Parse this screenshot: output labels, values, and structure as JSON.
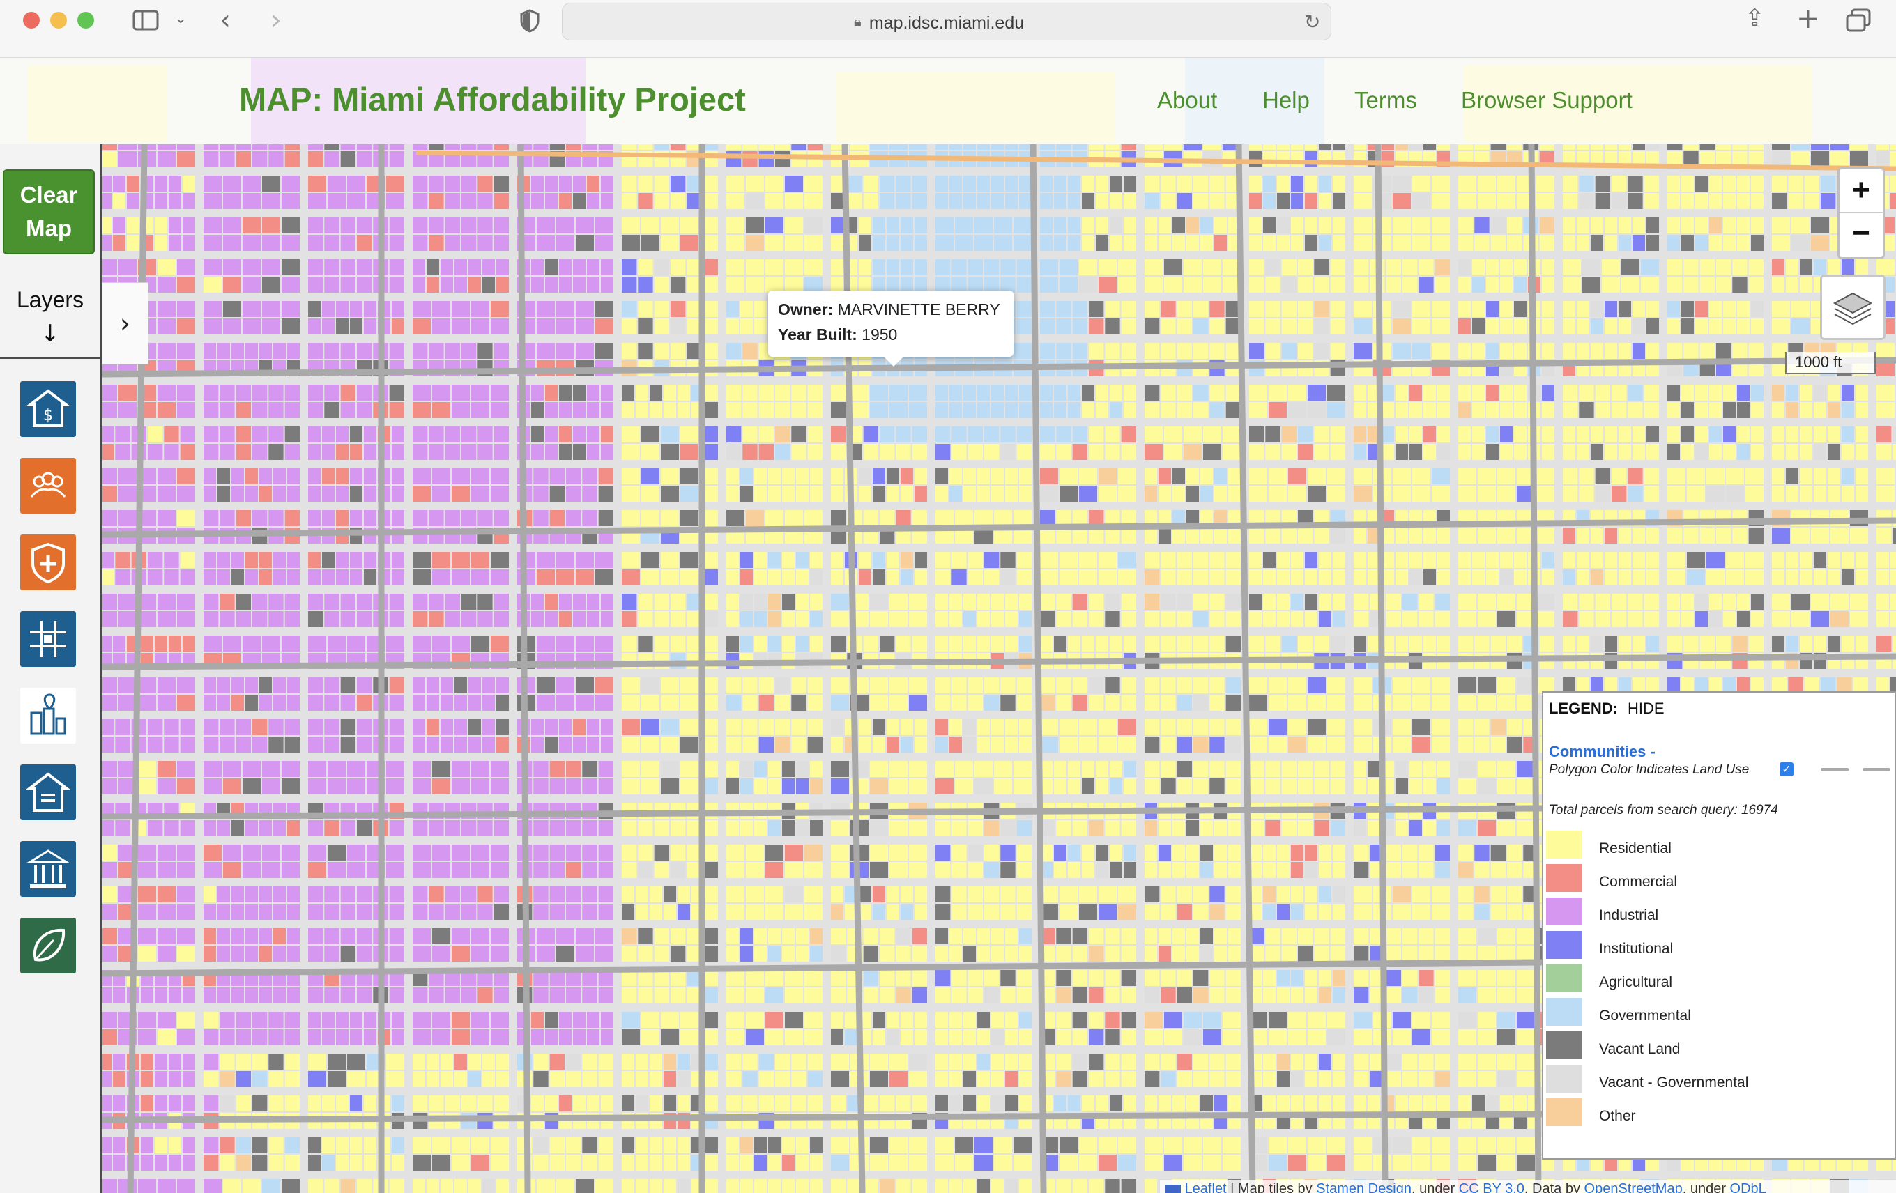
{
  "browser": {
    "url": "map.idsc.miami.edu",
    "traffic_colors": [
      "#ed6a5e",
      "#f5bf4f",
      "#61c554"
    ]
  },
  "header": {
    "title": "MAP: Miami Affordability Project",
    "nav": [
      {
        "label": "About"
      },
      {
        "label": "Help"
      },
      {
        "label": "Terms"
      },
      {
        "label": "Browser Support"
      }
    ]
  },
  "sidebar": {
    "clear_button": "Clear Map",
    "layers_label": "Layers",
    "layers_arrow": "↓",
    "expand_arrow": "›",
    "icons": [
      {
        "name": "housing-price-icon",
        "color": "#1f5f8f"
      },
      {
        "name": "community-icon",
        "color": "#e26f2c"
      },
      {
        "name": "health-shield-icon",
        "color": "#e26f2c"
      },
      {
        "name": "grid-plan-icon",
        "color": "#1f5f8f"
      },
      {
        "name": "location-city-icon",
        "color": "#1f5f8f"
      },
      {
        "name": "home-list-icon",
        "color": "#1f5f8f"
      },
      {
        "name": "government-building-icon",
        "color": "#1f5f8f"
      },
      {
        "name": "environment-leaf-icon",
        "color": "#2f6b47"
      }
    ]
  },
  "map": {
    "tooltip": {
      "owner_label": "Owner:",
      "owner_value": "MARVINETTE BERRY",
      "year_label": "Year Built:",
      "year_value": "1950"
    },
    "zoom_in": "+",
    "zoom_out": "−",
    "scale_label": "1000 ft"
  },
  "legend": {
    "title": "LEGEND:",
    "toggle": "HIDE",
    "communities_label": "Communities -",
    "polygon_note": "Polygon Color Indicates Land Use",
    "total_text": "Total parcels from search query: 16974",
    "items": [
      {
        "label": "Residential",
        "color": "#fdfb9a"
      },
      {
        "label": "Commercial",
        "color": "#f28e86"
      },
      {
        "label": "Industrial",
        "color": "#d597ef"
      },
      {
        "label": "Institutional",
        "color": "#8080f5"
      },
      {
        "label": "Agricultural",
        "color": "#a3cf9a"
      },
      {
        "label": "Governmental",
        "color": "#bcdcf5"
      },
      {
        "label": "Vacant Land",
        "color": "#7b7b7b"
      },
      {
        "label": "Vacant - Governmental",
        "color": "#dedede"
      },
      {
        "label": "Other",
        "color": "#f8cf9a"
      }
    ]
  },
  "attribution": {
    "leaflet": "Leaflet",
    "text1": " | Map tiles by ",
    "stamen": "Stamen Design",
    "text2": ", under ",
    "ccby": "CC BY 3.0",
    "text3": ". Data by ",
    "osm": "OpenStreetMap",
    "text4": ", under ",
    "odbl": "ODbL"
  }
}
